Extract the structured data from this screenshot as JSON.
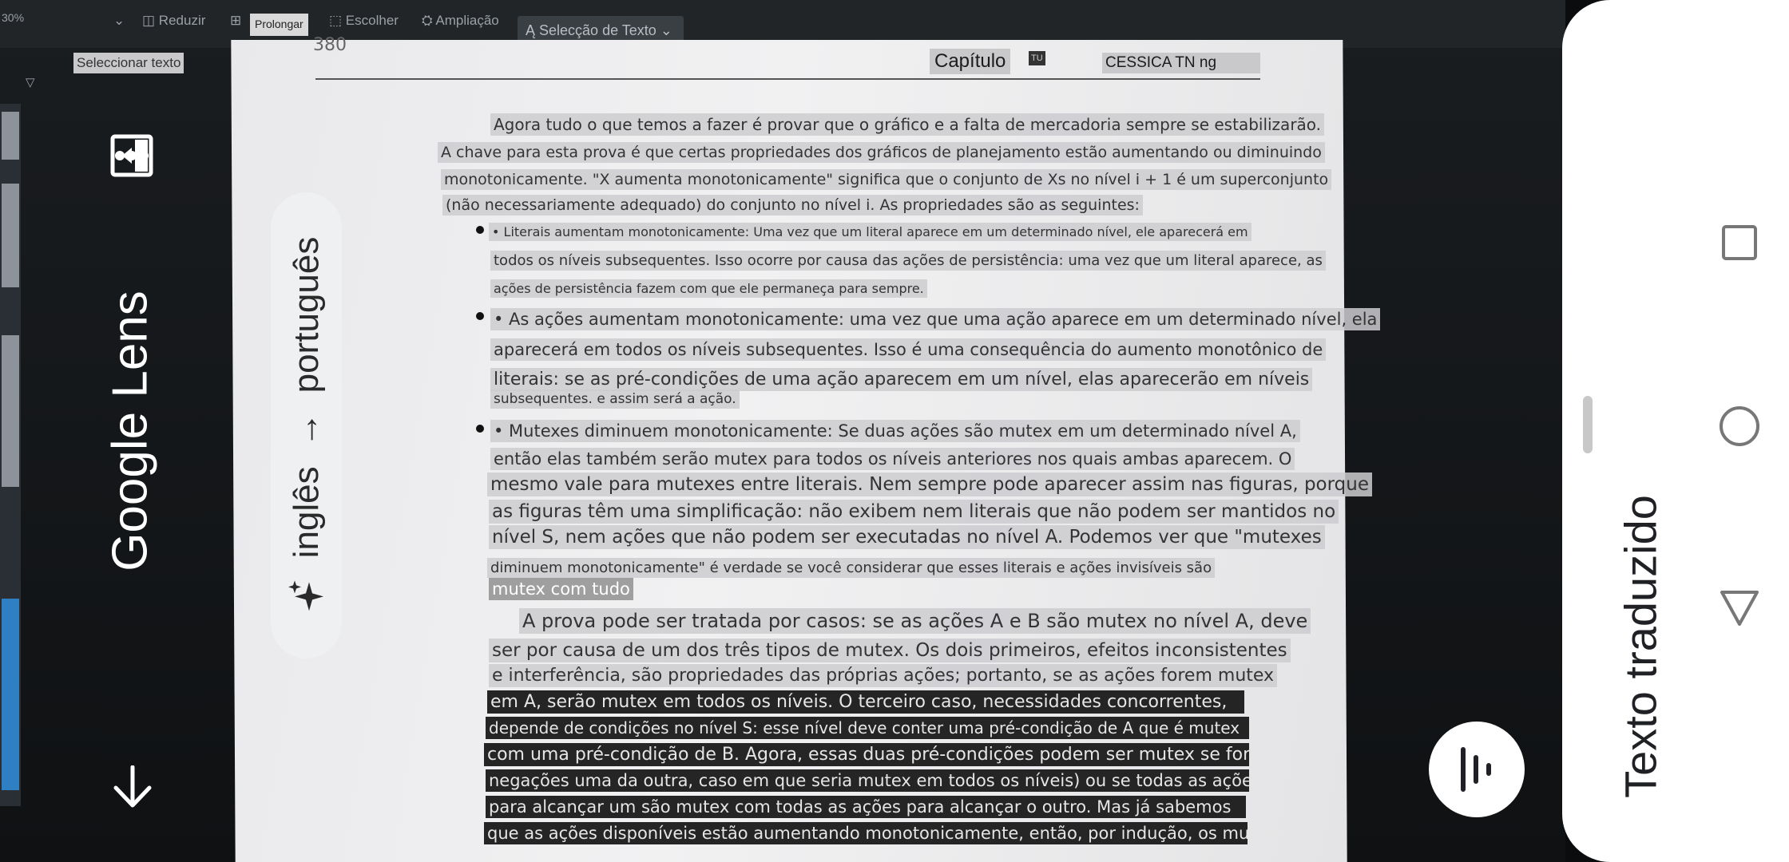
{
  "toolbar": {
    "zoom": "30%",
    "reduce": "Reduzir",
    "extend": "Prolongar",
    "choose": "Escolher",
    "enlarge": "Ampliação",
    "text_selection": "Selecção de Texto",
    "select_text_chip": "Seleccionar texto"
  },
  "page": {
    "number": "380",
    "header_chapter": "Capítulo",
    "header_tu": "TU",
    "header_right": "CESSICA TN ng",
    "lines": {
      "p1_l1": "Agora tudo o que temos a fazer é provar que o gráfico e a falta de mercadoria sempre se estabilizarão.",
      "p1_l2": "A chave para esta prova é que certas propriedades dos gráficos de planejamento estão aumentando ou diminuindo",
      "p1_l3": "monotonicamente. \"X aumenta monotonicamente\" significa que o conjunto de Xs no nível i + 1 é um superconjunto",
      "p1_l4": "(não necessariamente adequado) do conjunto no nível i. As propriedades são as seguintes:",
      "b1_l1": "• Literais aumentam monotonicamente: Uma vez que um literal aparece em um determinado nível, ele aparecerá em",
      "b1_l2": "todos os níveis subsequentes. Isso ocorre por causa das ações de persistência: uma vez que um literal aparece, as",
      "b1_l3": "ações de persistência fazem com que ele permaneça para sempre.",
      "b2_l1": "• As ações aumentam monotonicamente: uma vez que uma ação aparece em um determinado nível, ela",
      "b2_l2": "aparecerá em todos os níveis subsequentes. Isso é uma consequência do aumento monotônico de",
      "b2_l3": "literais: se as pré-condições de uma ação aparecem em um nível, elas aparecerão em níveis",
      "b2_l4": "subsequentes. e assim será a ação.",
      "b3_l1": "• Mutexes diminuem monotonicamente: Se duas ações são mutex em um determinado nível A,",
      "b3_l2": "então elas também serão mutex para todos os níveis anteriores nos quais ambas aparecem. O",
      "b3_l3": "mesmo vale para mutexes entre literais. Nem sempre pode aparecer assim nas figuras, porque",
      "b3_l4": "as figuras têm uma simplificação: não exibem nem literais que não podem ser mantidos no",
      "b3_l5": "nível S, nem ações que não podem ser executadas no nível A. Podemos ver que \"mutexes",
      "b3_l6": "diminuem monotonicamente\" é verdade se você considerar que esses literais e ações invisíveis são",
      "b3_l7": "mutex com tudo",
      "p2_l1": "A prova pode ser tratada por casos: se as ações A e B são mutex no nível A, deve",
      "p2_l2": "ser por causa de um dos três tipos de mutex. Os dois primeiros, efeitos inconsistentes",
      "p2_l3": "e interferência, são propriedades das próprias ações; portanto, se as ações forem mutex",
      "p2_l4": "em A, serão mutex em todos os níveis. O terceiro caso, necessidades concorrentes,",
      "p2_l5": "depende de condições no nível S: esse nível deve conter uma pré-condição de A que é mutex",
      "p2_l6": "com uma pré-condição de B. Agora, essas duas pré-condições podem ser mutex se forem",
      "p2_l7": "negações uma da outra, caso em que seria mutex em todos os níveis) ou se todas as ações",
      "p2_l8": "para alcançar um são mutex com todas as ações para alcançar o outro. Mas já sabemos",
      "p2_l9": "que as ações disponíveis estão aumentando monotonicamente, então, por indução, os mutexes"
    }
  },
  "lens": {
    "title": "Google Lens",
    "source_lang": "inglês",
    "arrow": "→",
    "target_lang": "português"
  },
  "panel": {
    "title": "Texto traduzido"
  },
  "colors": {
    "overlay_bg": "#0b0c0d",
    "panel_bg": "#ffffff",
    "pill_bg": "#eef0f1"
  }
}
